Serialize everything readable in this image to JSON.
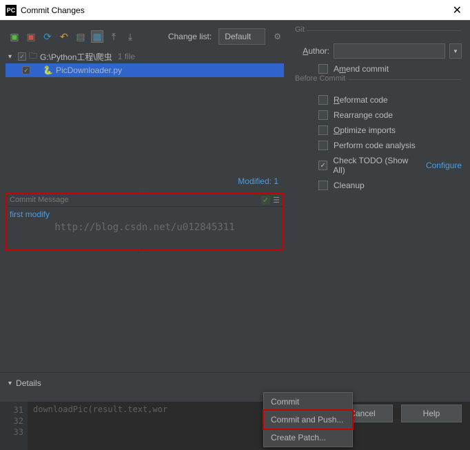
{
  "titlebar": {
    "icon": "PC",
    "title": "Commit Changes"
  },
  "toolbar": {
    "change_list_label": "Change list:",
    "change_list_value": "Default"
  },
  "tree": {
    "root_path": "G:\\Python工程\\爬虫",
    "file_count": "1 file",
    "file_name": "PicDownloader.py"
  },
  "modified": "Modified: 1",
  "commit_message": {
    "label": "Commit Message",
    "value": "first modify"
  },
  "watermark": "http://blog.csdn.net/u012845311",
  "git": {
    "group_label": "Git",
    "author_label": "Author:",
    "amend_label": "Amend commit"
  },
  "before_commit": {
    "group_label": "Before Commit",
    "reformat": "Reformat code",
    "rearrange": "Rearrange code",
    "optimize": "Optimize imports",
    "analysis": "Perform code analysis",
    "todo": "Check TODO (Show All)",
    "configure": "Configure",
    "cleanup": "Cleanup"
  },
  "details_label": "Details",
  "buttons": {
    "commit": "Commit",
    "cancel": "Cancel",
    "help": "Help"
  },
  "menu": {
    "commit": "Commit",
    "commit_push": "Commit and Push...",
    "create_patch": "Create Patch..."
  },
  "editor": {
    "lines": [
      "31",
      "32",
      "33"
    ],
    "code": "downloadPic(result.text,wor"
  }
}
